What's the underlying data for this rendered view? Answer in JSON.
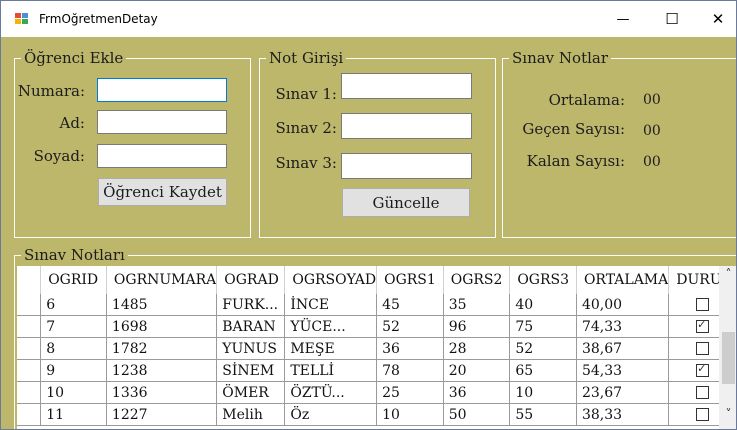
{
  "window": {
    "title": "FrmOğretmenDetay",
    "minimize_glyph": "—",
    "maximize_glyph": "☐",
    "close_glyph": "✕"
  },
  "icons": {
    "app": "form-window-icon",
    "minimize": "minimize-icon",
    "maximize": "maximize-icon",
    "close": "close-icon"
  },
  "ogrenci_ekle": {
    "title": "Öğrenci Ekle",
    "numara_label": "Numara:",
    "numara_value": "",
    "ad_label": "Ad:",
    "ad_value": "",
    "soyad_label": "Soyad:",
    "soyad_value": "",
    "save_button": "Öğrenci Kaydet"
  },
  "not_girisi": {
    "title": "Not Girişi",
    "sinav1_label": "Sınav 1:",
    "sinav2_label": "Sınav 2:",
    "sinav3_label": "Sınav 3:",
    "sinav1_value": "",
    "sinav2_value": "",
    "sinav3_value": "",
    "update_button": "Güncelle"
  },
  "sinav_notlar": {
    "title": "Sınav Notlar",
    "ortalama_label": "Ortalama:",
    "ortalama_value": "00",
    "gecen_label": "Geçen Sayısı:",
    "gecen_value": "00",
    "kalan_label": "Kalan Sayısı:",
    "kalan_value": "00"
  },
  "grid": {
    "title": "Sınav Notları",
    "columns": [
      "OGRID",
      "OGRNUMARA",
      "OGRAD",
      "OGRSOYAD",
      "OGRS1",
      "OGRS2",
      "OGRS3",
      "ORTALAMA",
      "DURUM"
    ],
    "rows": [
      {
        "OGRID": "6",
        "OGRNUMARA": "1485",
        "OGRAD": "FURK...",
        "OGRSOYAD": "İNCE",
        "OGRS1": "45",
        "OGRS2": "35",
        "OGRS3": "40",
        "ORTALAMA": "40,00",
        "DURUM": false
      },
      {
        "OGRID": "7",
        "OGRNUMARA": "1698",
        "OGRAD": "BARAN",
        "OGRSOYAD": "YÜCE...",
        "OGRS1": "52",
        "OGRS2": "96",
        "OGRS3": "75",
        "ORTALAMA": "74,33",
        "DURUM": true
      },
      {
        "OGRID": "8",
        "OGRNUMARA": "1782",
        "OGRAD": "YUNUS",
        "OGRSOYAD": "MEŞE",
        "OGRS1": "36",
        "OGRS2": "28",
        "OGRS3": "52",
        "ORTALAMA": "38,67",
        "DURUM": false
      },
      {
        "OGRID": "9",
        "OGRNUMARA": "1238",
        "OGRAD": "SİNEM",
        "OGRSOYAD": "TELLİ",
        "OGRS1": "78",
        "OGRS2": "20",
        "OGRS3": "65",
        "ORTALAMA": "54,33",
        "DURUM": true
      },
      {
        "OGRID": "10",
        "OGRNUMARA": "1336",
        "OGRAD": "ÖMER",
        "OGRSOYAD": "ÖZTÜ...",
        "OGRS1": "25",
        "OGRS2": "36",
        "OGRS3": "10",
        "ORTALAMA": "23,67",
        "DURUM": false
      },
      {
        "OGRID": "11",
        "OGRNUMARA": "1227",
        "OGRAD": "Melih",
        "OGRSOYAD": "Öz",
        "OGRS1": "10",
        "OGRS2": "50",
        "OGRS3": "55",
        "ORTALAMA": "38,33",
        "DURUM": false
      }
    ]
  },
  "scrollbar": {
    "up_glyph": "˄",
    "down_glyph": "˅"
  }
}
